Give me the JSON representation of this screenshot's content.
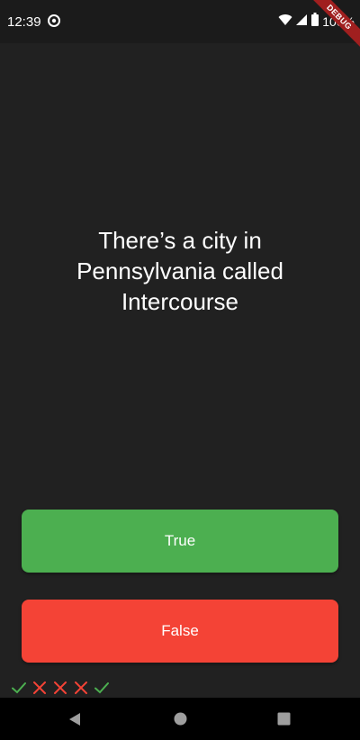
{
  "status_bar": {
    "time": "12:39",
    "battery": "100%",
    "icons": [
      "notification-icon",
      "wifi-icon",
      "signal-icon",
      "battery-icon"
    ]
  },
  "debug_banner": {
    "label": "DEBUG"
  },
  "quiz": {
    "question": "There’s a city in Pennsylvania called Intercourse"
  },
  "buttons": {
    "true_label": "True",
    "false_label": "False"
  },
  "score_keeper": {
    "results": [
      "correct",
      "wrong",
      "wrong",
      "wrong",
      "correct"
    ]
  },
  "colors": {
    "background": "#212121",
    "true_button": "#4caf50",
    "false_button": "#f44336",
    "correct_icon": "#4caf50",
    "wrong_icon": "#f44336"
  },
  "nav_bar": {
    "icons": [
      "back-icon",
      "home-icon",
      "recents-icon"
    ]
  }
}
